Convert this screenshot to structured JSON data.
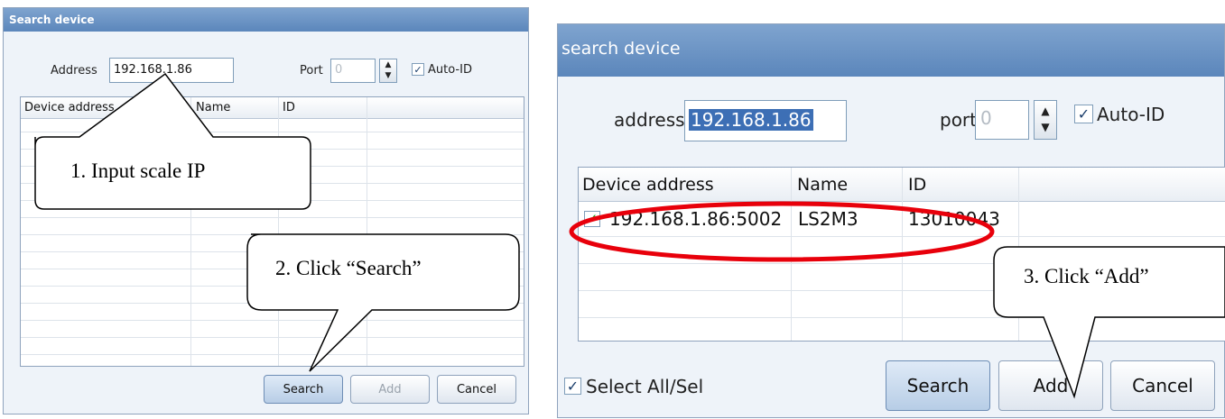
{
  "left_dialog": {
    "title": "Search device",
    "address_label": "Address",
    "address_value": "192.168.1.86",
    "port_label": "Port",
    "port_value": "0",
    "auto_id_label": "Auto-ID",
    "auto_id_checked": true,
    "columns": [
      "Device address",
      "Name",
      "ID"
    ],
    "rows": [],
    "buttons": {
      "search": "Search",
      "add": "Add",
      "cancel": "Cancel"
    }
  },
  "right_dialog": {
    "title": "search device",
    "address_label": "address",
    "address_value": "192.168.1.86",
    "port_label": "port",
    "port_value": "0",
    "auto_id_label": "Auto-ID",
    "auto_id_checked": true,
    "columns": [
      "Device address",
      "Name",
      "ID"
    ],
    "rows": [
      {
        "checked": true,
        "device_address": "192.168.1.86:5002",
        "name": "LS2M3",
        "id": "13010043"
      }
    ],
    "select_all_label": "Select All/Sel",
    "select_all_checked": true,
    "buttons": {
      "search": "Search",
      "add": "Add",
      "cancel": "Cancel"
    }
  },
  "annotations": {
    "step1": "1.   Input scale IP",
    "step2": "2. Click “Search”",
    "step3": "3. Click “Add”",
    "highlight_color": "#e8000b"
  }
}
